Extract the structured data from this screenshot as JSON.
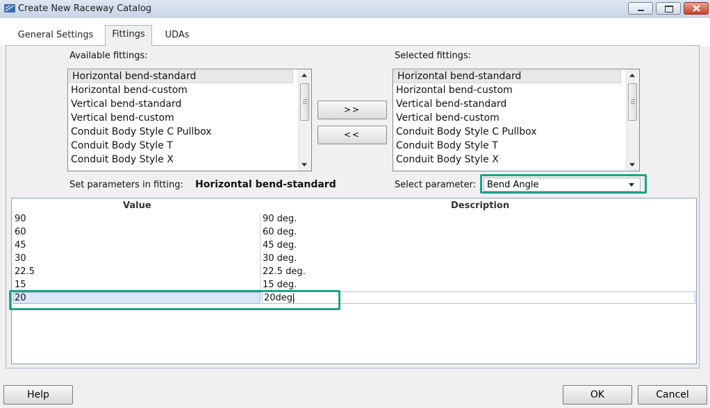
{
  "window": {
    "title": "Create New Raceway Catalog"
  },
  "tabs": [
    {
      "label": "General Settings",
      "active": false
    },
    {
      "label": "Fittings",
      "active": true
    },
    {
      "label": "UDAs",
      "active": false
    }
  ],
  "available": {
    "label": "Available fittings:",
    "items": [
      "Horizontal bend-standard",
      "Horizontal bend-custom",
      "Vertical bend-standard",
      "Vertical bend-custom",
      "Conduit Body Style C Pullbox",
      "Conduit Body Style T",
      "Conduit Body Style X"
    ],
    "selected_index": 0
  },
  "selected": {
    "label": "Selected fittings:",
    "items": [
      "Horizontal bend-standard",
      "Horizontal bend-custom",
      "Vertical bend-standard",
      "Vertical bend-custom",
      "Conduit Body Style C Pullbox",
      "Conduit Body Style T",
      "Conduit Body Style X"
    ],
    "selected_index": 0
  },
  "transfer": {
    "add_label": ">>",
    "remove_label": "<<"
  },
  "set_params": {
    "label": "Set parameters in fitting:",
    "fitting": "Horizontal bend-standard"
  },
  "select_param": {
    "label": "Select parameter:",
    "value": "Bend Angle"
  },
  "grid": {
    "columns": [
      "Value",
      "Description"
    ],
    "rows": [
      [
        "90",
        "90 deg."
      ],
      [
        "60",
        "60 deg."
      ],
      [
        "45",
        "45 deg."
      ],
      [
        "30",
        "30 deg."
      ],
      [
        "22.5",
        "22.5 deg."
      ],
      [
        "15",
        "15 deg."
      ]
    ],
    "new_row": {
      "value": "20",
      "description": "20deg."
    }
  },
  "buttons": {
    "help": "Help",
    "ok": "OK",
    "cancel": "Cancel"
  },
  "colors": {
    "highlight": "#1fa185",
    "titlebar": "#c8d5e6"
  }
}
